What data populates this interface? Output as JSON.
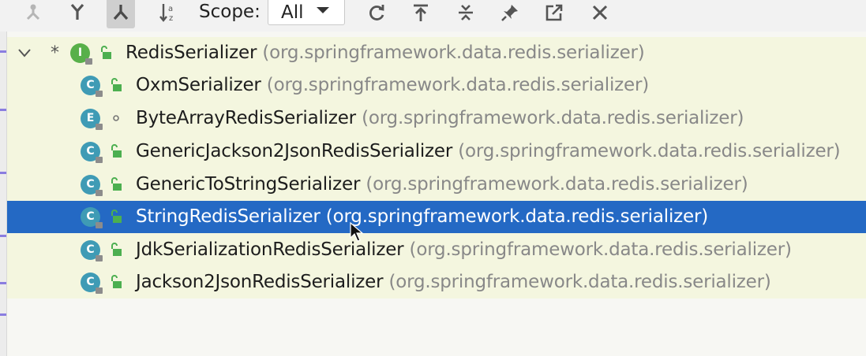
{
  "toolbar": {
    "buttons": [
      {
        "name": "supertypes-hierarchy-icon",
        "active": false
      },
      {
        "name": "subtypes-hierarchy-icon",
        "active": false
      },
      {
        "name": "class-hierarchy-icon",
        "active": true
      },
      {
        "name": "sort-alphabetically-icon",
        "active": false
      }
    ],
    "scope_label": "Scope:",
    "scope_value": "All",
    "right_buttons": [
      "refresh-icon",
      "export-icon",
      "collapse-all-icon",
      "pin-icon",
      "open-in-new-icon",
      "close-icon"
    ]
  },
  "tree": {
    "root": {
      "star": "*",
      "badge": "I",
      "name": "RedisSerializer",
      "package": "(org.springframework.data.redis.serializer)",
      "expanded": true
    },
    "children": [
      {
        "badge": "C",
        "visibility": "public",
        "name": "OxmSerializer",
        "package": "(org.springframework.data.redis.serializer)",
        "selected": false
      },
      {
        "badge": "E",
        "visibility": "package-private",
        "name": "ByteArrayRedisSerializer",
        "package": "(org.springframework.data.redis.serializer)",
        "selected": false
      },
      {
        "badge": "C",
        "visibility": "public",
        "name": "GenericJackson2JsonRedisSerializer",
        "package": "(org.springframework.data.redis.serializer)",
        "selected": false
      },
      {
        "badge": "C",
        "visibility": "public",
        "name": "GenericToStringSerializer",
        "package": "(org.springframework.data.redis.serializer)",
        "selected": false
      },
      {
        "badge": "C",
        "visibility": "public",
        "name": "StringRedisSerializer",
        "package": "(org.springframework.data.redis.serializer)",
        "selected": true
      },
      {
        "badge": "C",
        "visibility": "public",
        "name": "JdkSerializationRedisSerializer",
        "package": "(org.springframework.data.redis.serializer)",
        "selected": false
      },
      {
        "badge": "C",
        "visibility": "public",
        "name": "Jackson2JsonRedisSerializer",
        "package": "(org.springframework.data.redis.serializer)",
        "selected": false
      }
    ]
  },
  "colors": {
    "selection": "#2469c4",
    "tree_background": "#f4f6df",
    "interface_badge": "#58b04a",
    "class_badge": "#3f9bb5",
    "package_text": "#888888"
  }
}
